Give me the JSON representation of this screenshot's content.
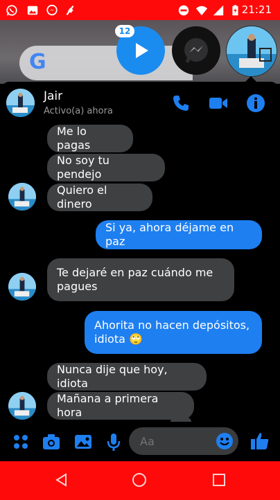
{
  "status_bar": {
    "time": "21:21",
    "left_icons": [
      "whatsapp-icon",
      "gallery-icon",
      "messenger-icon",
      "bug-icon"
    ],
    "right_icons": [
      "dnd-icon",
      "wifi-icon",
      "signal-icon",
      "battery-charging-icon"
    ],
    "bar_color": "#ff0a0a"
  },
  "chat_heads": {
    "badge_count": "12",
    "items": [
      "play-chat-head",
      "messenger-chat-head",
      "avatar-chat-head"
    ]
  },
  "home_widget": {
    "search_logo": "G"
  },
  "header": {
    "name": "Jair",
    "status": "Activo(a) ahora",
    "actions": [
      "phone-icon",
      "video-icon",
      "info-icon"
    ],
    "accent_color": "#1e7ff0"
  },
  "messages": [
    {
      "from": "them",
      "text": "Me lo pagas"
    },
    {
      "from": "them",
      "text": "No soy tu pendejo"
    },
    {
      "from": "them",
      "text": "Quiero el dinero"
    },
    {
      "from": "me",
      "text": "Si ya, ahora déjame en paz"
    },
    {
      "from": "them",
      "text": "Te dejaré en paz cuándo me pagues"
    },
    {
      "from": "me",
      "text": "Ahorita no hacen depósitos, idiota 🙄"
    },
    {
      "from": "them",
      "text": "Nunca dije que hoy, idiota"
    },
    {
      "from": "them",
      "text": "Mañana a primera hora"
    }
  ],
  "composer": {
    "placeholder": "Aa",
    "icons": [
      "apps-icon",
      "camera-icon",
      "image-icon",
      "mic-icon",
      "emoji-icon",
      "like-icon"
    ]
  },
  "nav_bar": {
    "buttons": [
      "back-button",
      "home-button",
      "recents-button"
    ]
  }
}
